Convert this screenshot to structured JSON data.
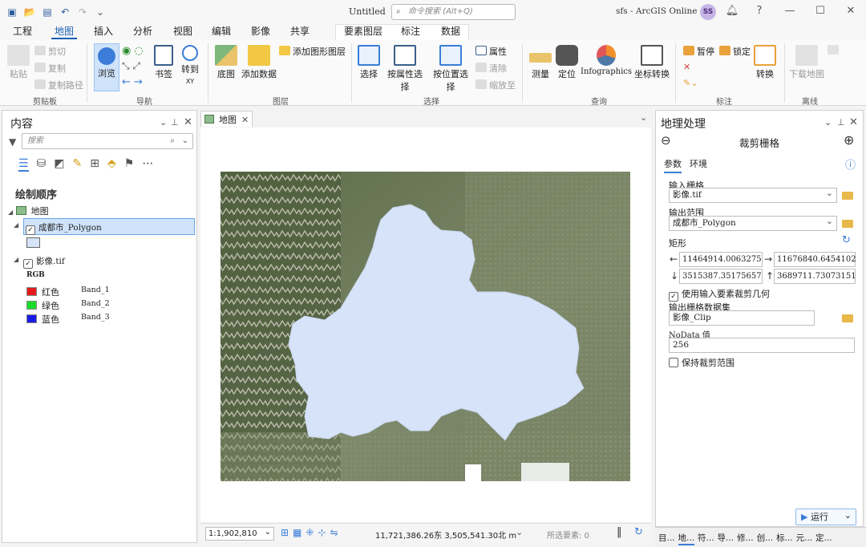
{
  "titlebar": {
    "doc_title": "Untitled",
    "command_search_placeholder": "命令搜索 (Alt+Q)",
    "account": "sfs - ArcGIS Online",
    "avatar_initials": "SS",
    "help": "?"
  },
  "menu": {
    "tabs": [
      "工程",
      "地图",
      "插入",
      "分析",
      "视图",
      "编辑",
      "影像",
      "共享"
    ],
    "active": "地图",
    "context_tabs": [
      "要素图层",
      "标注",
      "数据"
    ]
  },
  "ribbon": {
    "clipboard": {
      "paste": "粘贴",
      "cut": "剪切",
      "copy": "复制",
      "copy_path": "复制路径",
      "label": "剪贴板"
    },
    "navigate": {
      "explore": "浏览",
      "bookmarks": "书签",
      "goto": "转到",
      "goto_sub": "XY",
      "label": "导航"
    },
    "layer": {
      "basemap": "底图",
      "add_data": "添加数据",
      "add_graphics": "添加图形图层",
      "label": "图层"
    },
    "selection": {
      "select": "选择",
      "by_attr": "按属性选择",
      "by_loc": "按位置选择",
      "attributes": "属性",
      "clear": "清除",
      "zoom_to": "缩放至",
      "label": "选择"
    },
    "inquiry": {
      "measure": "测量",
      "locate": "定位",
      "infographics": "Infographics",
      "coord_conv": "坐标转换",
      "label": "查询"
    },
    "labeling": {
      "pause": "暂停",
      "lock": "锁定",
      "convert": "转换",
      "label": "标注"
    },
    "offline": {
      "download_map": "下载地图",
      "label": "离线"
    }
  },
  "contents": {
    "title": "内容",
    "search_placeholder": "搜索",
    "drawing_order": "绘制顺序",
    "map_name": "地图",
    "layer1": "成都市_Polygon",
    "layer2": "影像.tif",
    "rgb_label": "RGB",
    "bands": [
      {
        "color_name": "红色",
        "band": "Band_1",
        "color": "#e31a1c"
      },
      {
        "color_name": "绿色",
        "band": "Band_2",
        "color": "#1bdb2a"
      },
      {
        "color_name": "蓝色",
        "band": "Band_3",
        "color": "#1a1ae3"
      }
    ],
    "polygon_fill": "#d6e3f8"
  },
  "map": {
    "tab_label": "地图",
    "scale": "1:1,902,810",
    "coords": "11,721,386.26东 3,505,541.30北 m",
    "selected_features": "所选要素: 0"
  },
  "geoprocessing": {
    "title": "地理处理",
    "tool_name": "裁剪栅格",
    "tab_params": "参数",
    "tab_env": "环境",
    "input_raster_label": "输入栅格",
    "input_raster_value": "影像.tif",
    "output_extent_label": "输出范围",
    "output_extent_value": "成都市_Polygon",
    "rectangle_label": "矩形",
    "left": "11464914.0063275",
    "right": "11676840.6454102",
    "bottom": "3515387.35175657",
    "top": "3689711.73073151",
    "use_clip_geom": "使用输入要素裁剪几何",
    "output_raster_label": "输出栅格数据集",
    "output_raster_value": "影像_Clip",
    "nodata_label": "NoData 值",
    "nodata_value": "256",
    "keep_extent": "保持裁剪范围",
    "run": "运行"
  },
  "bottom_tabs": [
    "目...",
    "地...",
    "符...",
    "导...",
    "修...",
    "创...",
    "标...",
    "元...",
    "定..."
  ]
}
